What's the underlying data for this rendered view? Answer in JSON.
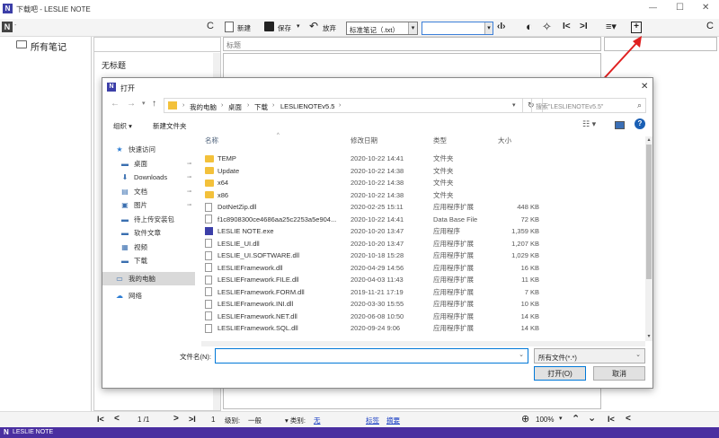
{
  "window": {
    "title": "下载吧 - LESLIE NOTE",
    "min": "—",
    "max": "☐",
    "close": "✕",
    "logo": "N"
  },
  "toolbar": {
    "refresh": "C",
    "new_label": "新建",
    "save_label": "保存",
    "save_arrow": "▾",
    "discard_label": "放弃",
    "filetype_value": "标准笔记（.txt）",
    "dropdown": "▾",
    "split": "‹I›",
    "contrast": "◐",
    "pin": "✧",
    "first": "I<",
    "last": ">I",
    "menu": "≡▾",
    "new_doc": "+",
    "refresh_right": "C"
  },
  "sidebar": {
    "all_notes": "所有笔记"
  },
  "notes_list": {
    "item": "无标题"
  },
  "editor": {
    "title_placeholder": "标题"
  },
  "bottom": {
    "first": "I<",
    "prev": "<",
    "page": "1 /1",
    "next": ">",
    "last": ">I",
    "num": "1",
    "level_label": "级别:",
    "level_value": "一般",
    "category_label": "▾ 类别:",
    "category_value": "无",
    "tags": "标签",
    "summary": "摘要",
    "zoom_value": "100%",
    "zoom_arrow": "▾",
    "collapse_up": "⌃",
    "collapse_down": "⌄",
    "bfirst": "I<",
    "bprev": "<"
  },
  "statusbar": {
    "logo_text": "LESLIE NOTE"
  },
  "dialog": {
    "title": "打开",
    "close": "✕",
    "back": "←",
    "forward": "→",
    "up": "↑",
    "breadcrumb": [
      "我的电脑",
      "桌面",
      "下载",
      "LESLIENOTEv5.5"
    ],
    "refresh": "↻",
    "search_placeholder": "搜索\"LESLIENOTEv5.5\"",
    "organize": "组织 ▾",
    "new_folder": "新建文件夹",
    "columns": {
      "name": "名称",
      "date": "修改日期",
      "type": "类型",
      "size": "大小"
    },
    "nav": [
      {
        "label": "快速访问",
        "icon": "★"
      },
      {
        "label": "桌面",
        "icon": "▬",
        "pin": "📌"
      },
      {
        "label": "Downloads",
        "icon": "⬇",
        "pin": "📌"
      },
      {
        "label": "文档",
        "icon": "▤",
        "pin": "📌"
      },
      {
        "label": "图片",
        "icon": "▣",
        "pin": "📌"
      },
      {
        "label": "待上传安装包",
        "icon": "▬"
      },
      {
        "label": "软件文章",
        "icon": "▬"
      },
      {
        "label": "视频",
        "icon": "▦"
      },
      {
        "label": "下载",
        "icon": "▬"
      },
      {
        "label": "我的电脑",
        "icon": "▭"
      },
      {
        "label": "网络",
        "icon": "☁"
      }
    ],
    "files": [
      {
        "name": "TEMP",
        "date": "2020-10-22 14:41",
        "type": "文件夹",
        "size": "",
        "kind": "folder"
      },
      {
        "name": "Update",
        "date": "2020-10-22 14:38",
        "type": "文件夹",
        "size": "",
        "kind": "folder"
      },
      {
        "name": "x64",
        "date": "2020-10-22 14:38",
        "type": "文件夹",
        "size": "",
        "kind": "folder"
      },
      {
        "name": "x86",
        "date": "2020-10-22 14:38",
        "type": "文件夹",
        "size": "",
        "kind": "folder"
      },
      {
        "name": "DotNetZip.dll",
        "date": "2020-02-25 15:11",
        "type": "应用程序扩展",
        "size": "448 KB",
        "kind": "file"
      },
      {
        "name": "f1c8908300ce4686aa25c2253a5e904...",
        "date": "2020-10-22 14:41",
        "type": "Data Base File",
        "size": "72 KB",
        "kind": "file"
      },
      {
        "name": "LESLIE NOTE.exe",
        "date": "2020-10-20 13:47",
        "type": "应用程序",
        "size": "1,359 KB",
        "kind": "app"
      },
      {
        "name": "LESLIE_UI.dll",
        "date": "2020-10-20 13:47",
        "type": "应用程序扩展",
        "size": "1,207 KB",
        "kind": "file"
      },
      {
        "name": "LESLIE_UI.SOFTWARE.dll",
        "date": "2020-10-18 15:28",
        "type": "应用程序扩展",
        "size": "1,029 KB",
        "kind": "file"
      },
      {
        "name": "LESLIEFramework.dll",
        "date": "2020-04-29 14:56",
        "type": "应用程序扩展",
        "size": "16 KB",
        "kind": "file"
      },
      {
        "name": "LESLIEFramework.FILE.dll",
        "date": "2020-04-03 11:43",
        "type": "应用程序扩展",
        "size": "11 KB",
        "kind": "file"
      },
      {
        "name": "LESLIEFramework.FORM.dll",
        "date": "2019-11-21 17:19",
        "type": "应用程序扩展",
        "size": "7 KB",
        "kind": "file"
      },
      {
        "name": "LESLIEFramework.INI.dll",
        "date": "2020-03-30 15:55",
        "type": "应用程序扩展",
        "size": "10 KB",
        "kind": "file"
      },
      {
        "name": "LESLIEFramework.NET.dll",
        "date": "2020-06-08 10:50",
        "type": "应用程序扩展",
        "size": "14 KB",
        "kind": "file"
      },
      {
        "name": "LESLIEFramework.SQL.dll",
        "date": "2020-09-24 9:06",
        "type": "应用程序扩展",
        "size": "14 KB",
        "kind": "file"
      }
    ],
    "filename_label": "文件名(N):",
    "filename_value": "",
    "filter_value": "所有文件(*.*)",
    "open_button": "打开(O)",
    "cancel_button": "取消"
  },
  "colors": {
    "accent": "#4a2fa0",
    "select": "#cce8ff",
    "arrow": "#e02020"
  }
}
